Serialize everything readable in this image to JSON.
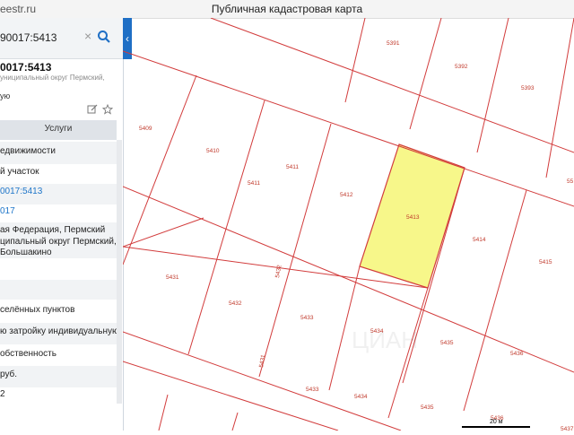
{
  "titlebar": {
    "site": "eestr.ru",
    "title": "Публичная кадастровая карта"
  },
  "search": {
    "value": "90017:5413"
  },
  "object": {
    "title": "0017:5413",
    "address": "униципальный округ Пермский,",
    "type": "ую"
  },
  "tabs": {
    "services": "Услуги"
  },
  "info_rows": [
    "едвижимости",
    "й участок",
    "0017:5413",
    "017",
    "ая Федерация, Пермский",
    "ципальный округ Пермский,",
    "Большакино",
    "",
    "",
    "селённых пунктов",
    "ю затройку индивидуальную",
    "обственность",
    "руб.",
    "2"
  ],
  "map": {
    "selected_color": "#f7f78a",
    "line_color": "#d23c3c",
    "label_color": "#c0392b",
    "parcel_labels": [
      "5391",
      "5392",
      "5393",
      "5409",
      "5410",
      "5411",
      "5411",
      "5412",
      "5413",
      "5414",
      "5415",
      "5431",
      "5432",
      "5432",
      "5433",
      "5434",
      "5435",
      "5436",
      "5431",
      "5433",
      "5434",
      "5435",
      "5436",
      "5437",
      "55"
    ],
    "scale_label": "20 м",
    "watermark": "ЦИАН"
  }
}
